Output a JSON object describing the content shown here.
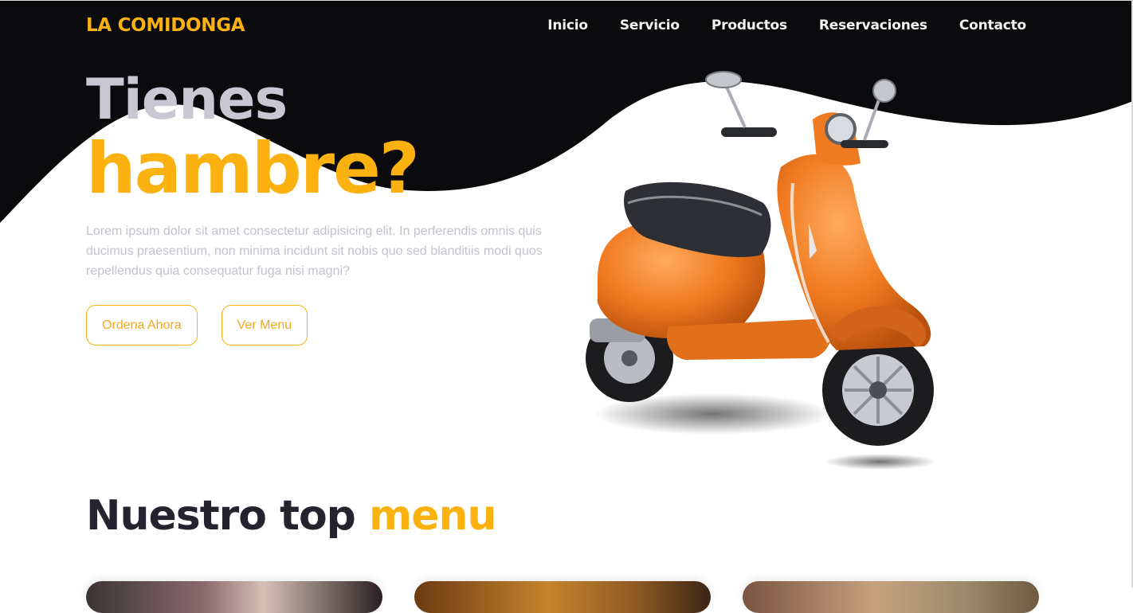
{
  "brand": {
    "name": "LA COMIDONGA",
    "color": "#fbb211"
  },
  "nav": {
    "items": [
      {
        "label": "Inicio"
      },
      {
        "label": "Servicio"
      },
      {
        "label": "Productos"
      },
      {
        "label": "Reservaciones"
      },
      {
        "label": "Contacto"
      }
    ]
  },
  "hero": {
    "line1": "Tienes",
    "line2": "hambre?",
    "description": "Lorem ipsum dolor sit amet consectetur adipisicing elit. In perferendis omnis quis ducimus praesentium, non minima incidunt sit nobis quo sed blanditiis modi quos repellendus quia consequatur fuga nisi magni?",
    "buttons": {
      "order": "Ordena Ahora",
      "menu": "Ver Menu"
    }
  },
  "menu_section": {
    "title_main": "Nuestro top",
    "title_accent": "menu"
  },
  "colors": {
    "accent": "#fbb211",
    "dark_background": "#0b0b0d",
    "heading_dark": "#24232e",
    "muted_text": "#c3c2cc",
    "scooter_body": "#f07a20"
  }
}
